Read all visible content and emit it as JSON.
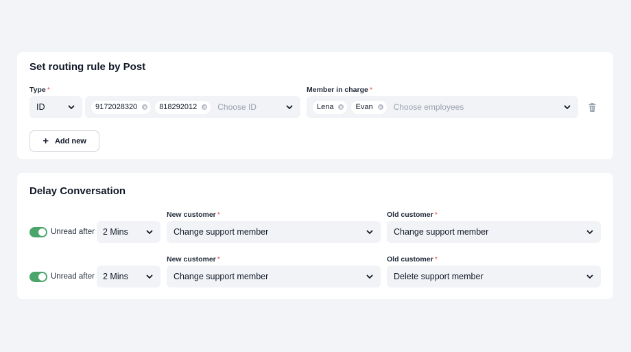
{
  "routing": {
    "title": "Set routing rule by Post",
    "type_label": "Type",
    "type_value": "ID",
    "ids": [
      "9172028320",
      "818292012"
    ],
    "id_placeholder": "Choose ID",
    "member_label": "Member in charge",
    "members": [
      "Lena",
      "Evan"
    ],
    "member_placeholder": "Choose employees",
    "add_button": "Add new"
  },
  "delay": {
    "title": "Delay Conversation",
    "rows": [
      {
        "enabled": true,
        "unread_label": "Unread after",
        "duration": "2 Mins",
        "new_label": "New customer",
        "new_value": "Change support member",
        "old_label": "Old customer",
        "old_value": "Change support member"
      },
      {
        "enabled": true,
        "unread_label": "Unread after",
        "duration": "2 Mins",
        "new_label": "New customer",
        "new_value": "Change support member",
        "old_label": "Old customer",
        "old_value": "Delete support member"
      }
    ]
  },
  "colors": {
    "toggle_on": "#4aa56a",
    "required": "#ef4444",
    "field_bg": "#f1f3f6",
    "page_bg": "#f2f4f7"
  },
  "icons": {
    "dropdown": "chevron-down-icon",
    "remove_chip": "close-icon",
    "delete": "trash-icon",
    "add": "plus-icon"
  }
}
